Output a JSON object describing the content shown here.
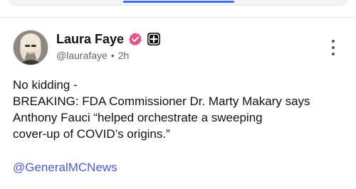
{
  "post": {
    "author": {
      "display_name": "Laura Faye",
      "handle": "@laurafaye",
      "separator": "•",
      "time": "2h",
      "verified_icon": "verified-badge-icon",
      "plus_icon": "plus-badge-icon"
    },
    "body_lines": [
      "No kidding -",
      "BREAKING: FDA Commissioner Dr. Marty Makary says",
      "Anthony Fauci “helped orchestrate a sweeping",
      "cover-up of COVID’s origins.”"
    ],
    "mention": "@GeneralMCNews",
    "more_icon": "more-vertical-icon"
  },
  "colors": {
    "verified": "#e94f8a",
    "link": "#4f5bd5",
    "tab_indicator": "#3f6df6",
    "secondary_text": "#666666"
  }
}
